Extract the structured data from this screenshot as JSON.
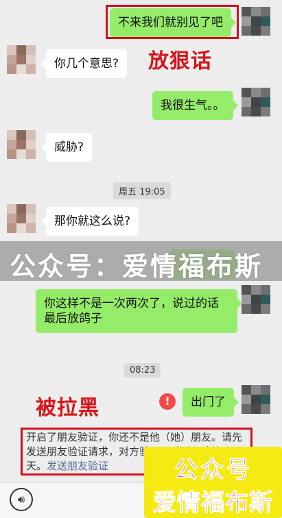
{
  "messages": [
    {
      "side": "right",
      "text": "不来我们就别见了吧"
    },
    {
      "side": "left",
      "text": "你几个意思?"
    },
    {
      "side": "right",
      "text": "我很生气。。"
    },
    {
      "side": "left",
      "text": "威胁?"
    },
    {
      "side": "left",
      "text": "那你就这么说?"
    },
    {
      "side": "right",
      "text": "你这样不是一次两次了，说过的话\n最后放鸽子"
    },
    {
      "side": "right",
      "text": "出门了"
    }
  ],
  "timestamps": [
    "周五 19:05",
    "08:23"
  ],
  "annotations": {
    "threat": "放狠话",
    "blocked": "被拉黑"
  },
  "banner": "公众号：爱情福布斯",
  "system_notice": {
    "text": "开启了朋友验证，你还不是他（她）朋友。请先发送朋友验证请求，对方验证通过后，才能聊天。",
    "link": "发送朋友验证"
  },
  "warning_icon": "!",
  "stamp": {
    "line1": "公众号",
    "line2": "爱情福布斯"
  },
  "colors": {
    "green_bubble": "#95ec69",
    "annotation_red": "#d8141a",
    "stamp_yellow": "#f5eb12"
  },
  "icons": {
    "voice": "voice-icon",
    "warning": "warning-icon"
  }
}
